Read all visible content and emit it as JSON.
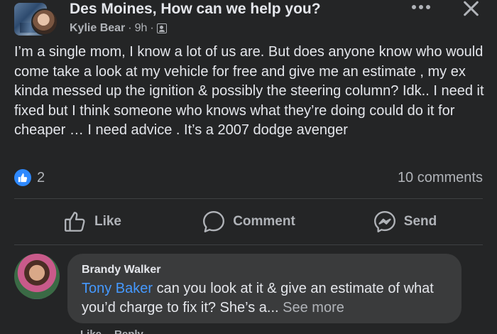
{
  "post": {
    "group_name": "Des Moines, How can we help you?",
    "author": "Kylie Bear",
    "separator": "·",
    "time": "9h",
    "separator2": "·",
    "privacy_icon": "group-members-icon",
    "body": "I’m a single mom, I know a lot of us are. But does anyone know who would come take a look at my vehicle for free and give me an estimate , my ex kinda messed up the ignition & possibly the steering column? Idk.. I need it fixed but I think someone who knows what they’re doing could do it for cheaper … I need advice . It’s a 2007 dodge avenger"
  },
  "reactions": {
    "icon": "like-icon",
    "count": "2",
    "comments": "10 comments"
  },
  "actions": {
    "like": "Like",
    "comment": "Comment",
    "send": "Send"
  },
  "comment": {
    "author": "Brandy Walker",
    "mention": "Tony Baker",
    "text": " can you look at it & give an estimate of what you’d charge to fix it? She’s a...",
    "see_more": "See more",
    "like": "Like",
    "reply": "Reply"
  },
  "colors": {
    "background": "#242526",
    "bubble": "#3a3b3c",
    "accent": "#2e89ff",
    "mention": "#4599ff",
    "text": "#e4e6eb",
    "secondary": "#b0b3b8"
  }
}
